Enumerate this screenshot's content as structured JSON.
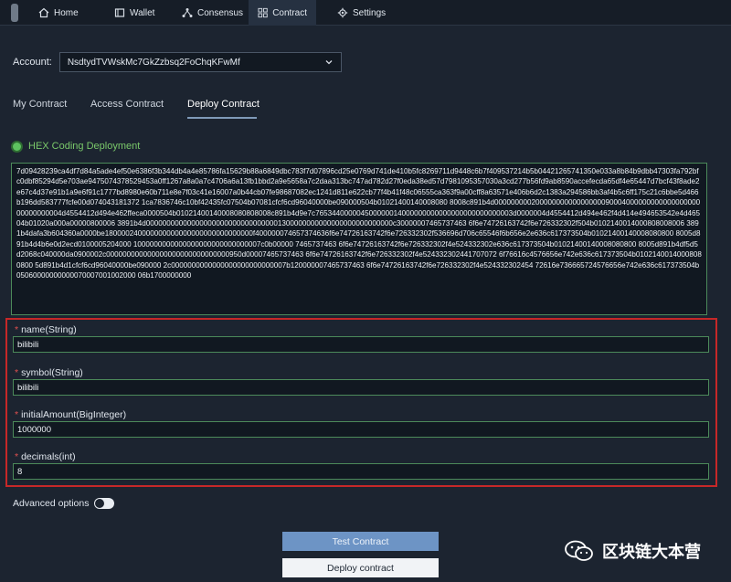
{
  "nav": {
    "items": [
      {
        "label": "Home",
        "icon": "home-icon"
      },
      {
        "label": "Wallet",
        "icon": "wallet-icon"
      },
      {
        "label": "Consensus",
        "icon": "consensus-icon"
      },
      {
        "label": "Contract",
        "icon": "contract-icon"
      },
      {
        "label": "Settings",
        "icon": "gear-icon"
      }
    ],
    "active": "Contract"
  },
  "account": {
    "label": "Account:",
    "value": "NsdtydTVWskMc7GkZzbsq2FoChqKFwMf"
  },
  "tabs": [
    {
      "label": "My Contract"
    },
    {
      "label": "Access Contract"
    },
    {
      "label": "Deploy Contract"
    }
  ],
  "active_tab": "Deploy Contract",
  "deploy_mode": {
    "label": "HEX Coding Deployment"
  },
  "hex_code": "7d09428239ca4df7d84a5ade4ef50e6386f3b344db4a4e85786fa15629b88a6849dbc783f7d07896cd25e0769d741de410b5fc8269711d9448c6b7f409537214b5b04421265741350e033a8b84b9dbb47303fa792bfc0dbf85294d5e703ae9475074378529453a0ff1267a8a0a7c4706a6a13fb1bbd2a9e5658a7c2daa313bc747ad782d27f0eda38ed57d7981095357030a3cd277b56fd9ab8590accefecda65df4e65447d7bcf43f8ade2e67c4d37e91b1a9e6f91c1777bd8980e60b711e8e7f03c41e16007a0b44cb07fe98687082ec1241d811e622cb77f4b41f48c06555ca363f9a00cff8a63571e406b6d2c1383a294586bb3af4b5c6ff175c21c6bbe5d466b196dd583777fcfe00d074043181372 1ca7836746c10bf42435fc07504b07081cfcf6cd96040000be090000504b01021400140008080 8008c891b4d0000000002000000000000000009000400000000000000000000000000004d4554412d494e462ffeca0000504b01021400140008080808008c891b4d9e7c765344000004500000014000000000000000000000000003d0000004d4554412d494e462f4d414e494653542e4d46504b01020a000a00000800006 3891b4d000000000000000000000000000000001300000000000000000000000000c30000007465737463 6f6e74726163742f6e726332302f504b0102140014000808008006 3891b4dafa3b604360a0000be180000240000000000000000000000000000f400000074657374636f6e74726163742f6e726332302f536696d706c65546f6b656e2e636c617373504b01021400140008080800 8005d891b4d4b6e0d2ecd0100005204000 1000000000000000000000000000007c0b00000 7465737463 6f6e74726163742f6e726332302f4e524332302e636c617373504b01021400140008080800 8005d891b4df5d5d2068c040000da0900002c000000000000000000000000000000950d00007465737463 6f6e74726163742f6e726332302f4e524332302441707072 6f76616c4576656e742e636c617373504b01021400140008080800 5d891b4d1cfcf6cd96040000be090000 2c0000000000000000000000000007b120000007465737463 6f6e74726163742f6e726332302f4e524332302454 72616e736665724576656e742e636c617373504b05060000000000070007001002000 06b1700000000",
  "params": [
    {
      "label": "name(String)",
      "value": "bilibili"
    },
    {
      "label": "symbol(String)",
      "value": "bilibili"
    },
    {
      "label": "initialAmount(BigInteger)",
      "value": "1000000"
    },
    {
      "label": "decimals(int)",
      "value": "8"
    }
  ],
  "required_mark": "*",
  "advanced": {
    "label": "Advanced options",
    "enabled": false
  },
  "buttons": {
    "test": "Test Contract",
    "deploy": "Deploy contract"
  },
  "watermark": {
    "text": "区块链大本营"
  },
  "colors": {
    "background": "#1c2430",
    "accent_green": "#5dc35f",
    "highlight_border": "#c62828",
    "test_button": "#6d94c5"
  }
}
